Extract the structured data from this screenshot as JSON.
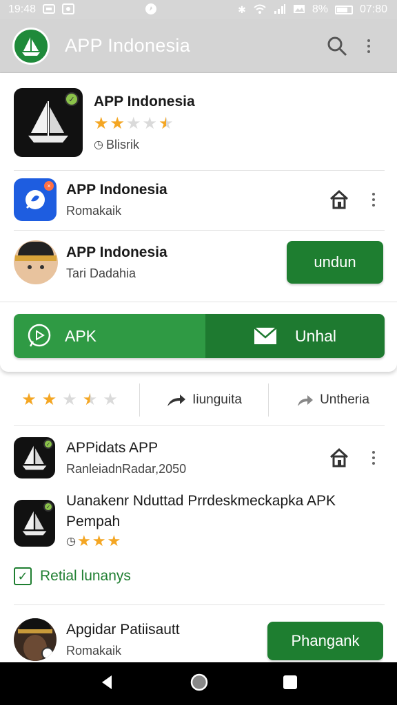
{
  "status_bar": {
    "time_left": "19:48",
    "battery_pct": "8%",
    "time_right": "07:80"
  },
  "app_bar": {
    "title": "APP Indonesia"
  },
  "featured": {
    "title": "APP Indonesia",
    "rating": 2.5,
    "meta": "Blisrik"
  },
  "list1": [
    {
      "title": "APP Indonesia",
      "subtitle": "Romakaik"
    },
    {
      "title": "APP Indonesia",
      "subtitle": "Tari Dadahia",
      "button": "undun"
    }
  ],
  "split_buttons": {
    "left": "APK",
    "right": "Unhal"
  },
  "stats": {
    "rating": 2.5,
    "share_label": "Iiunguita",
    "other_label": "Untheria"
  },
  "list2": [
    {
      "title": "APPidats APP",
      "subtitle": "RanleiadnRadar,2050"
    },
    {
      "title": "Uanakenr Nduttad Prrdeskmeckapka APK",
      "subtitle": "Pempah",
      "rating": 3
    }
  ],
  "checkbox": {
    "label": "Retial lunanys",
    "checked": true
  },
  "bottom_item": {
    "title": "Apgidar Patiisautt",
    "subtitle": "Romakaik",
    "button": "Phangank"
  },
  "colors": {
    "primary_green": "#1e7e30",
    "light_green": "#2f9a44",
    "star": "#f4a623",
    "app_bar": "#d4d4d4"
  }
}
